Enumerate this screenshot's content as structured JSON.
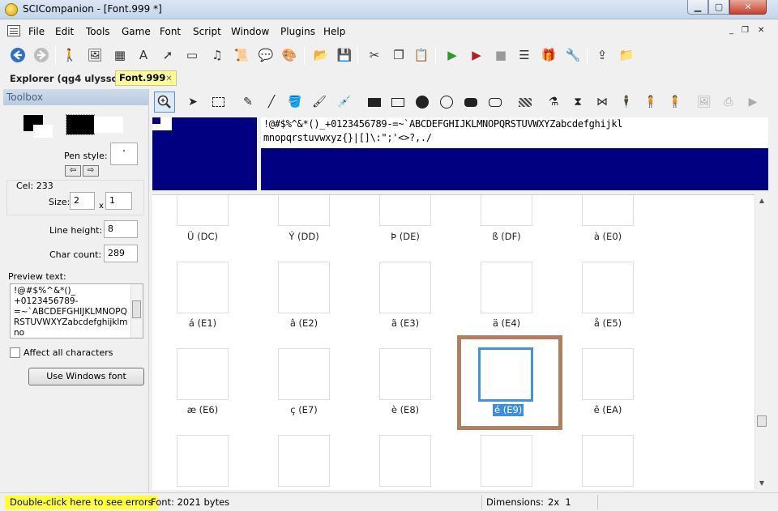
{
  "window": {
    "title": "SCICompanion - [Font.999 *]",
    "min_glyph": "▁",
    "max_glyph": "▢",
    "close_glyph": "✕"
  },
  "menu": {
    "items": [
      "File",
      "Edit",
      "Tools",
      "Game",
      "Font",
      "Script",
      "Window",
      "Plugins",
      "Help"
    ],
    "mdi_min": "_",
    "mdi_restore": "❐",
    "mdi_close": "✕"
  },
  "tabs": {
    "explorer": "Explorer (qg4 ulysson)",
    "font": "Font.999",
    "font_pin": "✕"
  },
  "toolbox": {
    "header": "Toolbox",
    "pen_style_label": "Pen style:",
    "pen_style_value": "·",
    "arrow_left": "⇦",
    "arrow_right": "⇨",
    "cel_label": "Cel: 233",
    "size_label": "Size:",
    "size_w": "2",
    "size_x": "x",
    "size_h": "1",
    "line_height_label": "Line height:",
    "line_height_value": "8",
    "char_count_label": "Char count:",
    "char_count_value": "289",
    "preview_text_label": "Preview text:",
    "preview_text": "!@#$%^&*()_\n+0123456789-\n=~`ABCDEFGHIJKLMNOPQ\nRSTUVWXYZabcdefghijklmno",
    "affect_all_label": "Affect all characters",
    "use_windows_font_label": "Use Windows font"
  },
  "charset_preview": {
    "line1": "!@#$%^&*()_+0123456789-=~`ABCDEFGHIJKLMNOPQRSTUVWXYZabcdefghijkl",
    "line2": "mnopqrstuvwxyz{}|[]\\:\";'<>?,./"
  },
  "grid": {
    "selected_label": "é (E9)",
    "rows": [
      [
        "Ü (DC)",
        "Ý (DD)",
        "Þ (DE)",
        "ß (DF)",
        "à (E0)"
      ],
      [
        "á (E1)",
        "â (E2)",
        "ã (E3)",
        "ä (E4)",
        "å (E5)"
      ],
      [
        "æ (E6)",
        "ç (E7)",
        "è (E8)",
        "é (E9)",
        "ê (EA)"
      ]
    ]
  },
  "status": {
    "errors": "Double-click here to see errors",
    "font_size": "Font: 2021 bytes",
    "dimensions_label": "Dimensions:",
    "dimensions_value": "2x  1"
  },
  "colors": {
    "preview_bg": "#000080",
    "selection_accent": "#3a8ee6",
    "selection_frame": "#b08060",
    "status_highlight": "#ffff33"
  }
}
